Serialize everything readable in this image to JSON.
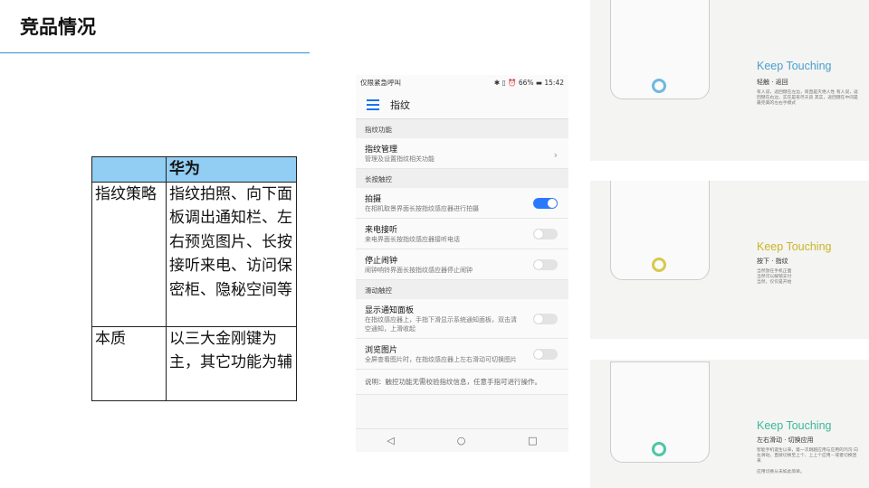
{
  "slide": {
    "title": "竞品情况"
  },
  "table": {
    "header": [
      "",
      "华为"
    ],
    "rows": [
      {
        "label": "指纹策略",
        "value": "指纹拍照、向下面板调出通知栏、左右预览图片、长按接听来电、访问保密柜、隐秘空间等"
      },
      {
        "label": "本质",
        "value": "以三大金刚键为主，其它功能为辅"
      }
    ]
  },
  "phone": {
    "status_left": "仅限紧急呼叫",
    "battery": "66%",
    "time": "15:42",
    "title": "指纹",
    "sections": [
      {
        "header": "指纹功能",
        "items": [
          {
            "title": "指纹管理",
            "sub": "管理及设置指纹相关功能",
            "type": "chevron"
          }
        ]
      },
      {
        "header": "长按触控",
        "items": [
          {
            "title": "拍摄",
            "sub": "在相机取景界面长按指纹感应器进行拍摄",
            "type": "toggle",
            "on": true
          },
          {
            "title": "来电接听",
            "sub": "来电界面长按指纹感应器接听电话",
            "type": "toggle",
            "on": false
          },
          {
            "title": "停止闹钟",
            "sub": "闹钟响铃界面长按指纹感应器停止闹钟",
            "type": "toggle",
            "on": false
          }
        ]
      },
      {
        "header": "滑动触控",
        "items": [
          {
            "title": "显示通知面板",
            "sub": "在指纹感应器上，手指下滑显示系统通知面板，双击清空通知，上滑收起",
            "type": "toggle",
            "on": false
          },
          {
            "title": "浏览图片",
            "sub": "全屏查看图片时，在指纹感应器上左右滑动可切换图片",
            "type": "toggle",
            "on": false
          }
        ]
      }
    ],
    "note": "说明：触控功能无需校验指纹信息，任意手指可进行操作。",
    "nav": [
      "◁",
      "○",
      "□"
    ]
  },
  "panels": [
    {
      "heading": "Keep Touching",
      "sub": "轻触 · 返回",
      "desc": "有人说，返回键在左边，简直是灭绝人性 有人说，返回键在右边，实在是丧尽天良 其实，返回键在中间是最完美的左右手模式",
      "color": "#4a9fd0"
    },
    {
      "heading": "Keep Touching",
      "sub": "按下 · 指纹",
      "desc": "当然放在手机正面 当然可以解锁支付 当然，仅仅是开始",
      "color": "#c9b52a"
    },
    {
      "heading": "Keep Touching",
      "sub": "左右滑动 · 切换应用",
      "desc": "智能手机诞生以来，第一次跳越应用与应用的鸿沟 向左滑动，直接切换至上个、上上个应用－或者切换回来",
      "desc2": "应用切换从未如此简单。",
      "color": "#3cb89a"
    }
  ]
}
